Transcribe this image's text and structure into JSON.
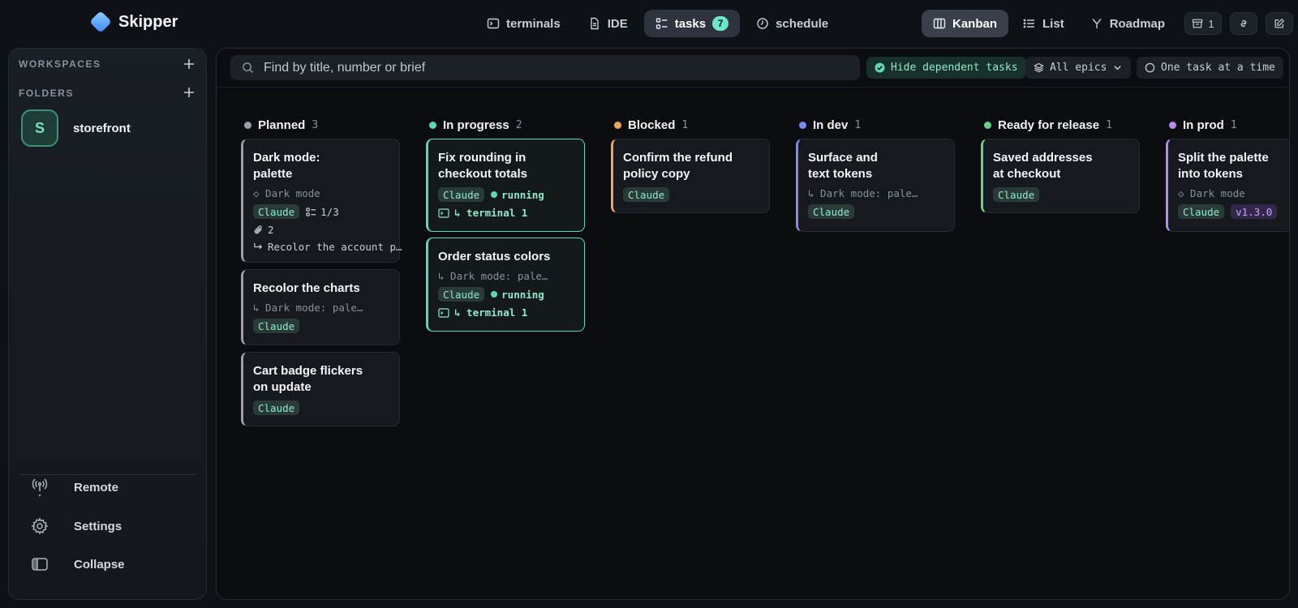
{
  "app": {
    "name": "Skipper"
  },
  "nav": {
    "terminals": "terminals",
    "ide": "IDE",
    "tasks": "tasks",
    "tasks_count": "7",
    "schedule": "schedule"
  },
  "views": {
    "kanban": "Kanban",
    "list": "List",
    "roadmap": "Roadmap",
    "archive_count": "1"
  },
  "sidebar": {
    "workspaces_label": "WORKSPACES",
    "folders_label": "FOLDERS",
    "folder": {
      "initial": "S",
      "name": "storefront"
    },
    "remote": "Remote",
    "settings": "Settings",
    "collapse": "Collapse"
  },
  "toolbar": {
    "search_placeholder": "Find by title, number or brief",
    "hide_dependent": "Hide dependent tasks",
    "epics": "All epics",
    "one_task": "One task at a time"
  },
  "colors": {
    "planned": "#9aa0a8",
    "in_progress": "#5fd6b6",
    "blocked": "#f0a35e",
    "in_dev": "#7c8cf0",
    "ready": "#6ccf86",
    "in_prod": "#b48cf0"
  },
  "columns": [
    {
      "title": "Planned",
      "count": "3",
      "cards": [
        {
          "title": "Dark mode:\npalette",
          "epic": "◇ Dark mode",
          "agent": "Claude",
          "checklist": "1/3",
          "attachments": "2",
          "next": "Recolor the account p…"
        },
        {
          "title": "Recolor the charts",
          "parent": "↳ Dark mode: pale…",
          "agent": "Claude"
        },
        {
          "title": "Cart badge flickers\non update",
          "agent": "Claude"
        }
      ]
    },
    {
      "title": "In progress",
      "count": "2",
      "cards": [
        {
          "title": "Fix rounding in\ncheckout totals",
          "agent": "Claude",
          "status": "running",
          "terminal": "↳ terminal 1"
        },
        {
          "title": "Order status colors",
          "parent": "↳ Dark mode: pale…",
          "agent": "Claude",
          "status": "running",
          "terminal": "↳ terminal 1"
        }
      ]
    },
    {
      "title": "Blocked",
      "count": "1",
      "cards": [
        {
          "title": "Confirm the refund\npolicy copy",
          "agent": "Claude"
        }
      ]
    },
    {
      "title": "In dev",
      "count": "1",
      "cards": [
        {
          "title": "Surface and\ntext tokens",
          "parent": "↳ Dark mode: pale…",
          "agent": "Claude"
        }
      ]
    },
    {
      "title": "Ready for release",
      "count": "1",
      "cards": [
        {
          "title": "Saved addresses\nat checkout",
          "agent": "Claude"
        }
      ]
    },
    {
      "title": "In prod",
      "count": "1",
      "cards": [
        {
          "title": "Split the palette\ninto tokens",
          "epic": "◇ Dark mode",
          "agent": "Claude",
          "version": "v1.3.0"
        }
      ]
    }
  ]
}
